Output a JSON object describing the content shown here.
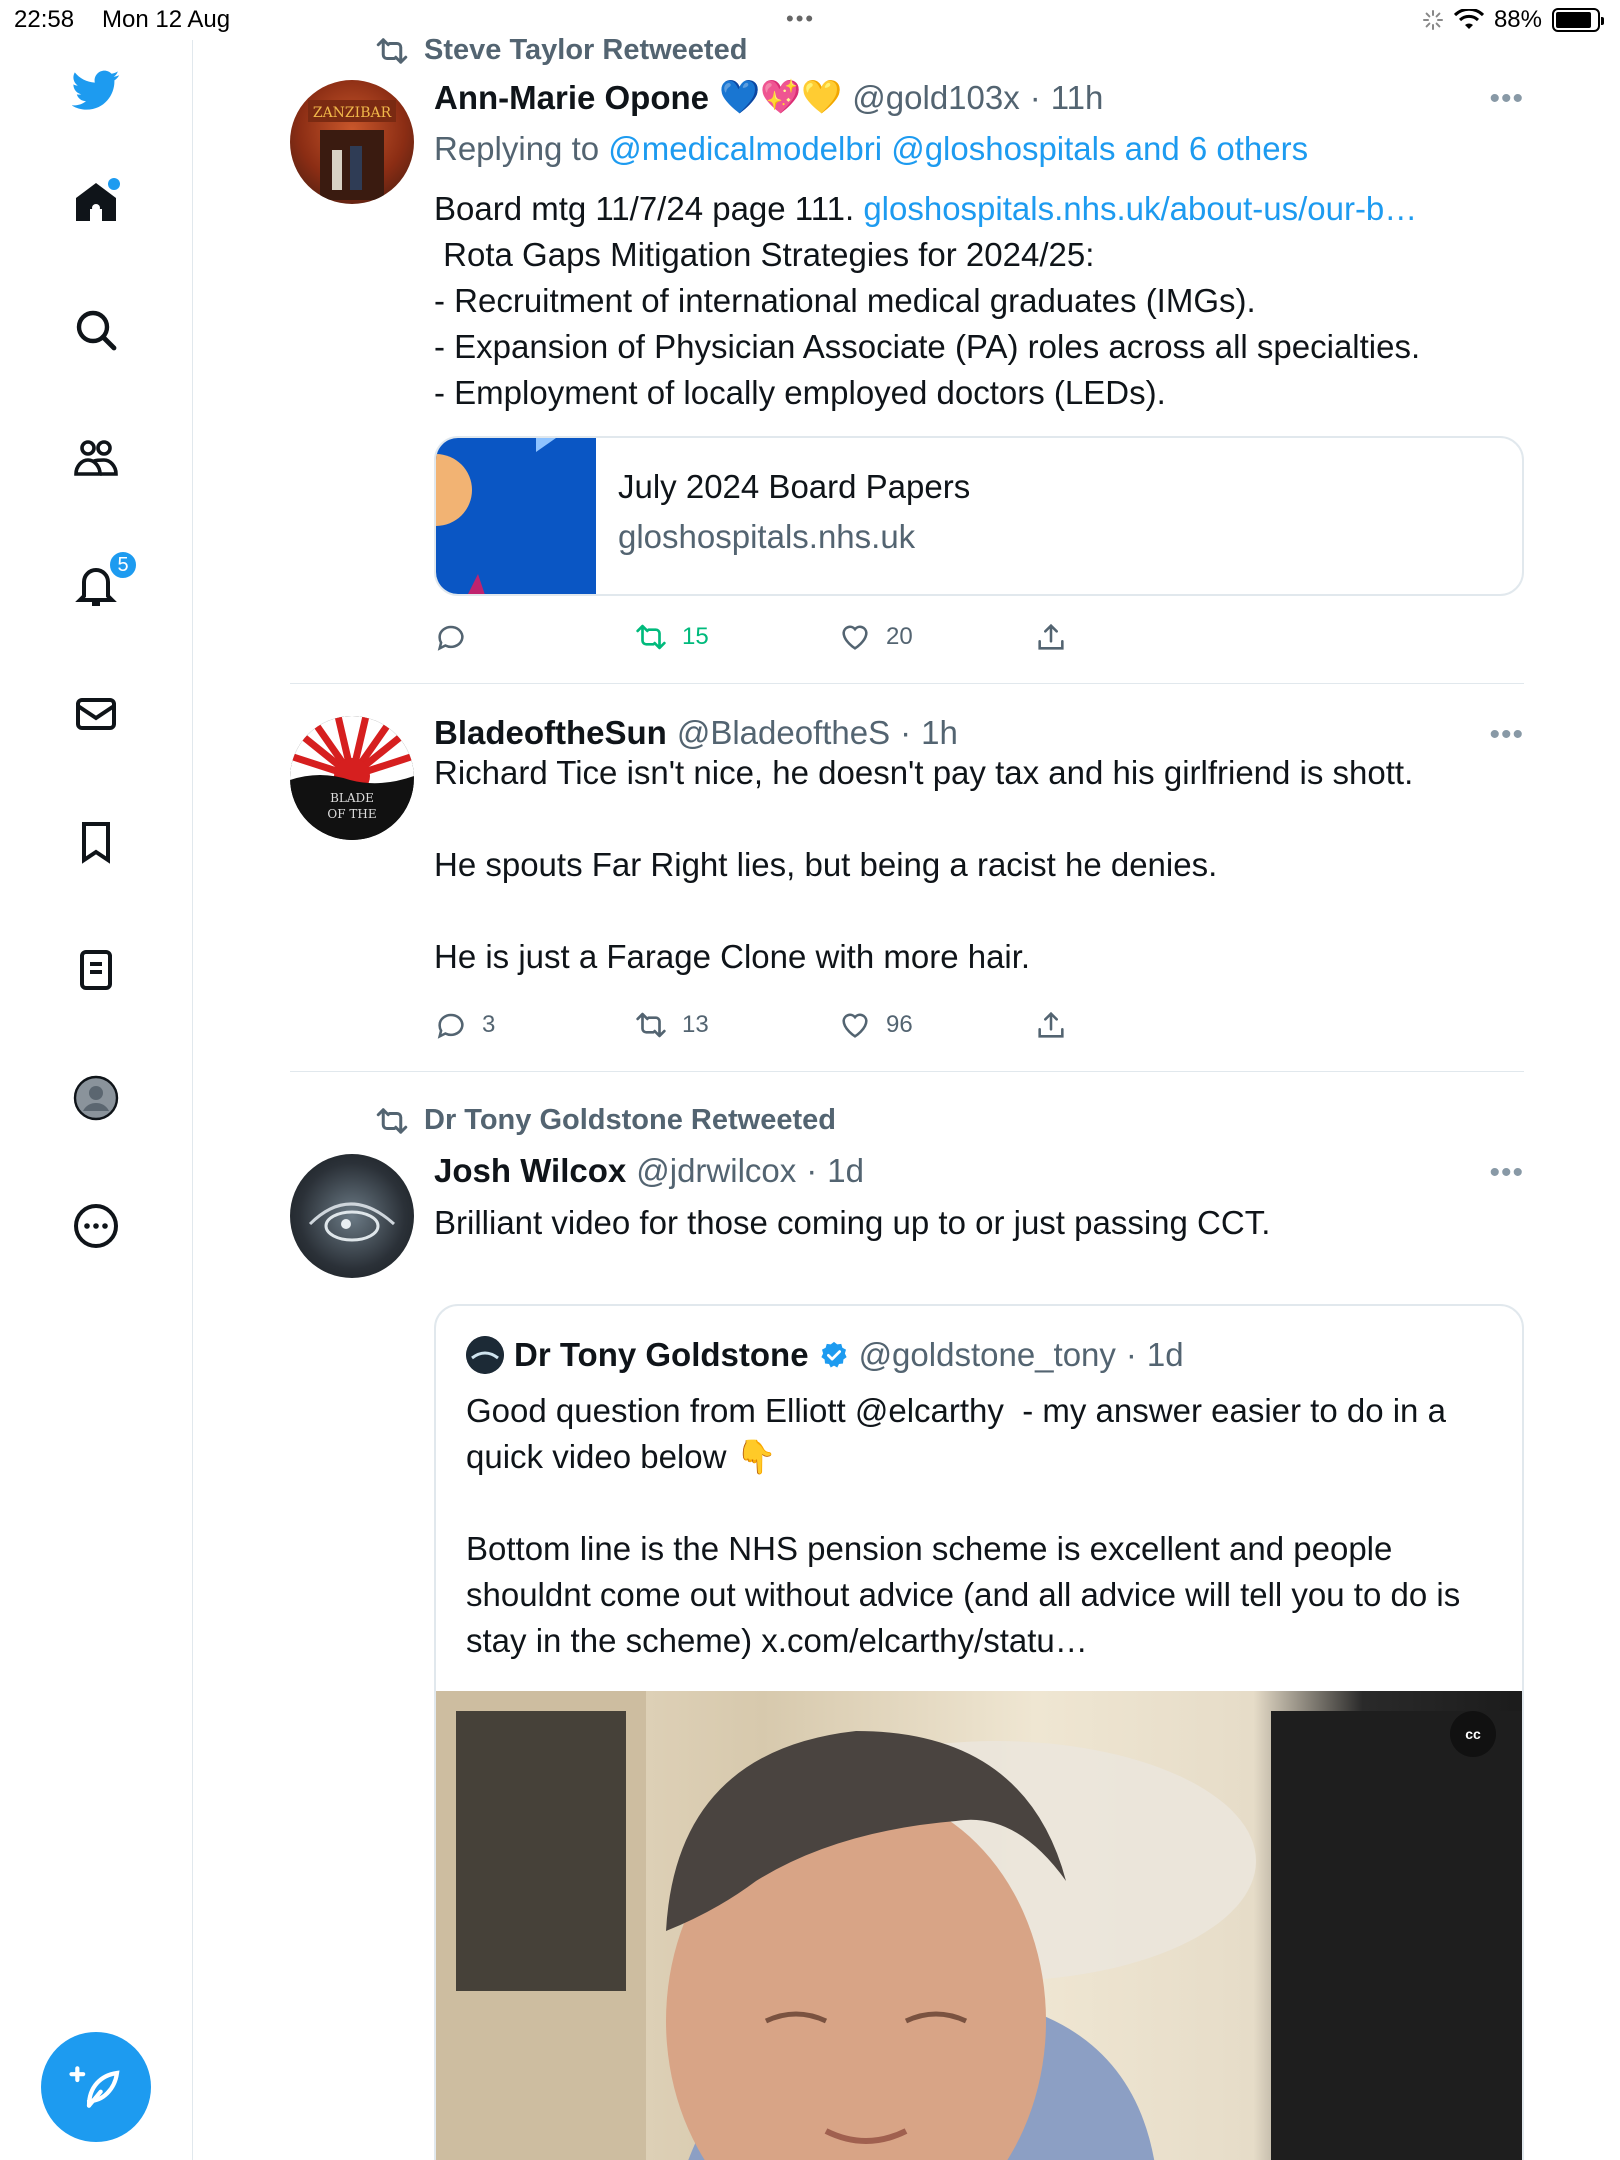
{
  "status_bar": {
    "time": "22:58",
    "date": "Mon 12 Aug",
    "battery": "88%",
    "battery_level": 0.88
  },
  "sidebar": {
    "notifications_badge": "5",
    "accent_color": "#1d9bf0"
  },
  "tweets": [
    {
      "retweeted_by": "Steve Taylor Retweeted",
      "name": "Ann-Marie Opone",
      "emojis": "💙💖💛",
      "handle": "@gold103x",
      "time": "11h",
      "reply_prefix": "Replying to ",
      "reply_targets": "@medicalmodelbri @gloshospitals and 6 others",
      "body_prefix": "Board mtg 11/7/24 page 111. ",
      "body_link": "gloshospitals.nhs.uk/about-us/our-b…",
      "body_rest": " Rota Gaps Mitigation Strategies for 2024/25:\n- Recruitment of international medical graduates (IMGs).\n- Expansion of Physician Associate (PA) roles across all specialties.\n- Employment of locally employed doctors (LEDs).",
      "card": {
        "title": "July 2024 Board Papers",
        "domain": "gloshospitals.nhs.uk"
      },
      "replies": "",
      "retweets": "15",
      "likes": "20"
    },
    {
      "name": "BladeoftheSun",
      "handle": "@BladeoftheS",
      "time": "1h",
      "body": "Richard Tice isn't nice, he doesn't pay tax and his girlfriend is shott.\n\nHe spouts Far Right lies, but being a racist he denies.\n\nHe is just a Farage Clone with more hair.",
      "replies": "3",
      "retweets": "13",
      "likes": "96"
    },
    {
      "retweeted_by": "Dr Tony Goldstone Retweeted",
      "name": "Josh Wilcox",
      "handle": "@jdrwilcox",
      "time": "1d",
      "body": "Brilliant video for those coming up to or just passing CCT.",
      "quote": {
        "name": "Dr Tony Goldstone",
        "handle": "@goldstone_tony",
        "time": "1d",
        "body": "Good question from Elliott @elcarthy  - my answer easier to do in a quick video below 👇\n\nBottom line is the NHS pension scheme is excellent and people shouldnt come out without advice (and all advice will tell you to do is stay in the scheme) x.com/elcarthy/statu…",
        "cc_label": "cc"
      }
    }
  ]
}
